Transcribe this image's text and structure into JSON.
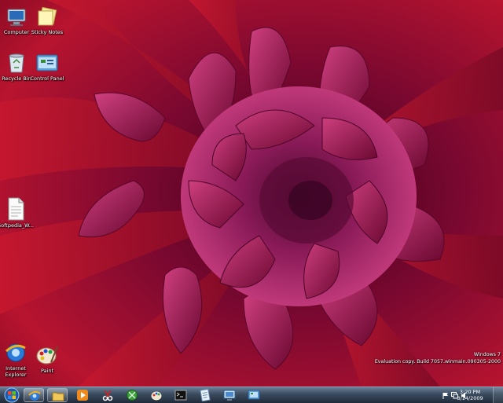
{
  "desktop": {
    "icons": [
      {
        "label": "Computer",
        "icon": "computer-icon"
      },
      {
        "label": "Sticky Notes",
        "icon": "sticky-notes-icon"
      },
      {
        "label": "Recycle Bin",
        "icon": "recycle-bin-icon"
      },
      {
        "label": "Control Panel",
        "icon": "control-panel-icon"
      },
      {
        "label": "Softpedia_W...",
        "icon": "text-file-icon"
      },
      {
        "label": "Internet Explorer",
        "icon": "internet-explorer-icon"
      },
      {
        "label": "Paint",
        "icon": "paint-icon"
      }
    ],
    "watermark": {
      "line1": "Windows 7",
      "line2": "Evaluation copy. Build 7057.winmain.090305-2000"
    }
  },
  "taskbar": {
    "start": "start-orb-icon",
    "buttons": [
      "internet-explorer-icon",
      "windows-explorer-icon",
      "media-player-icon",
      "snipping-tool-icon",
      "xbox-icon",
      "paint-icon",
      "command-prompt-icon",
      "notepad-icon",
      "remote-desktop-icon",
      "control-panel-icon"
    ],
    "tray": {
      "time": "3:20 PM",
      "date": "3/14/2009",
      "icons": [
        "action-center-flag-icon",
        "network-icon",
        "volume-icon"
      ]
    }
  },
  "colors": {
    "wallpaper_dark": "#5a0518",
    "wallpaper_red": "#b0102e",
    "petal_magenta": "#a0195a",
    "taskbar": "#2c3a4d"
  }
}
